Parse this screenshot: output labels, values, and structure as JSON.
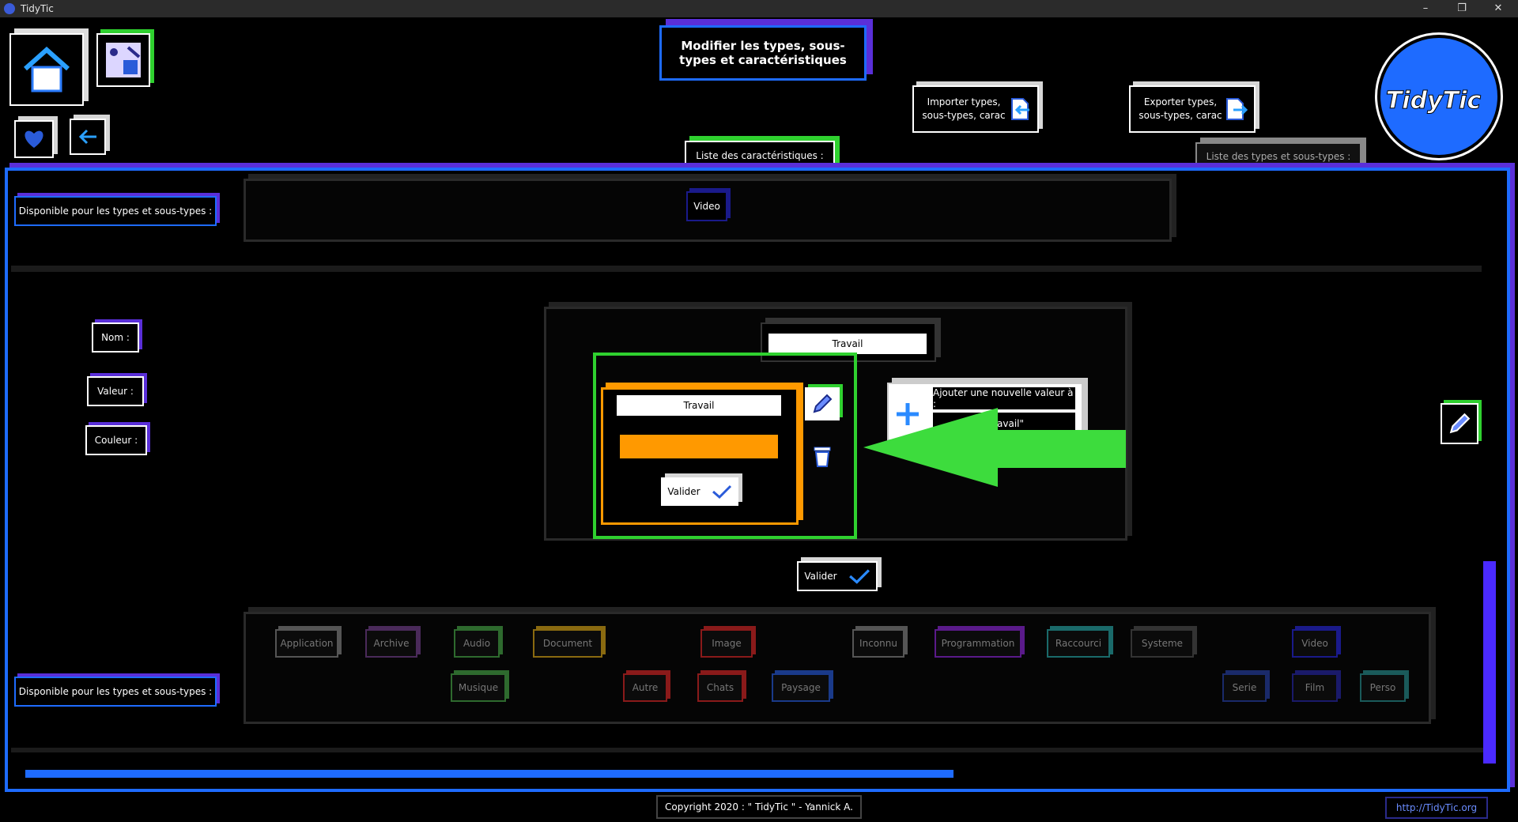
{
  "window": {
    "title": "TidyTic",
    "controls": {
      "minimize": "–",
      "maximize": "❐",
      "close": "✕"
    }
  },
  "header": {
    "title": "Modifier les types, sous-types et caractéristiques",
    "import_label": "Importer types, sous-types, carac",
    "export_label": "Exporter types, sous-types, carac",
    "logo_text": "TidyTic"
  },
  "tabs": {
    "characteristics": "Liste des caractéristiques :",
    "types": "Liste des types et sous-types :"
  },
  "top_section": {
    "available_label": "Disponible pour les types et sous-types :",
    "selected_chip": "Video"
  },
  "form": {
    "name_label": "Nom :",
    "value_label": "Valeur :",
    "color_label": "Couleur :",
    "name_value": "Travail",
    "edit_card": {
      "value_input": "Travail",
      "color_swatch": "#ff9900",
      "validate": "Valider"
    },
    "add_value": {
      "line1": "Ajouter une nouvelle valeur à :",
      "line2": "\"Travail\""
    },
    "validate": "Valider"
  },
  "bottom_section": {
    "available_label": "Disponible pour les types et sous-types :",
    "chips": [
      {
        "label": "Application",
        "color": "#555555"
      },
      {
        "label": "Archive",
        "color": "#4a2a5a"
      },
      {
        "label": "Audio",
        "color": "#2e6a2e"
      },
      {
        "label": "Musique",
        "color": "#2e6a2e"
      },
      {
        "label": "Document",
        "color": "#8a6a10"
      },
      {
        "label": "Image",
        "color": "#8a1a1a"
      },
      {
        "label": "Autre",
        "color": "#8a1a1a"
      },
      {
        "label": "Chats",
        "color": "#8a1a1a"
      },
      {
        "label": "Paysage",
        "color": "#1a3a8a"
      },
      {
        "label": "Inconnu",
        "color": "#555555"
      },
      {
        "label": "Programmation",
        "color": "#5a1a8a"
      },
      {
        "label": "Raccourci",
        "color": "#1a6a6a"
      },
      {
        "label": "Systeme",
        "color": "#333333"
      },
      {
        "label": "Video",
        "color": "#1a1a8a"
      },
      {
        "label": "Serie",
        "color": "#1a2a6a"
      },
      {
        "label": "Film",
        "color": "#1a1a6a"
      },
      {
        "label": "Perso",
        "color": "#1a5a5a"
      }
    ]
  },
  "footer": {
    "copyright": "Copyright 2020 : \" TidyTic \" - Yannick A.",
    "website": "http://TidyTic.org"
  },
  "colors": {
    "accent_blue": "#1e6bff",
    "accent_purple": "#5a2fd9",
    "highlight_green": "#2fd12f",
    "arrow_green": "#3ddc3d",
    "orange": "#ff9900"
  }
}
